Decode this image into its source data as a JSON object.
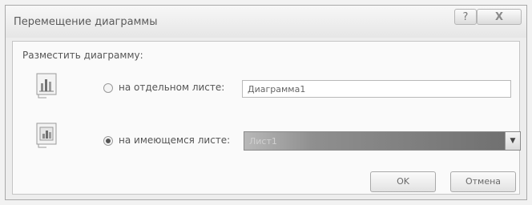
{
  "dialog": {
    "title": "Перемещение диаграммы",
    "help_label": "?",
    "close_label": "X"
  },
  "group_label": "Разместить диаграмму:",
  "options": [
    {
      "label": "на отдельном листе:",
      "selected": false,
      "icon": "chart-sheet-icon"
    },
    {
      "label": "на имеющемся листе:",
      "selected": true,
      "icon": "embedded-chart-icon"
    }
  ],
  "new_sheet_input": {
    "value": "Диаграмма1"
  },
  "sheet_select": {
    "value": "Лист1",
    "arrow_icon": "chevron-down-icon"
  },
  "buttons": {
    "ok": "OK",
    "cancel": "Отмена"
  },
  "colors": {
    "selected_fill": "#7a7a7a",
    "dialog_bg": "#ededed"
  }
}
